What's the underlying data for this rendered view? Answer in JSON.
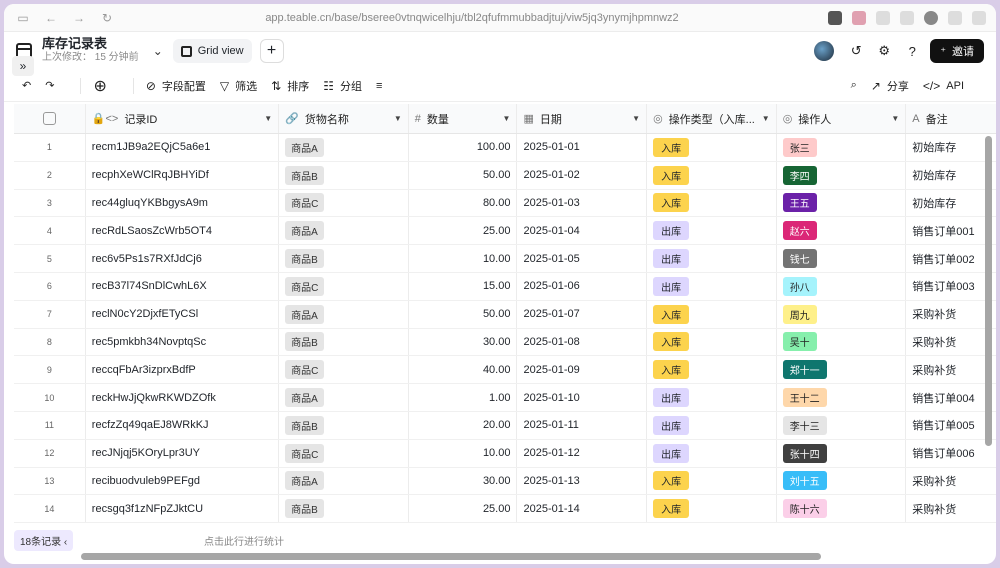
{
  "browser": {
    "url": "app.teable.cn/base/bseree0vtnqwicelhju/tbl2qfufmmubbadjtuj/viw5jq3ynymjhpmnwz2"
  },
  "header": {
    "title": "库存记录表",
    "subtitle": "上次修改： 15 分钟前",
    "view_label": "Grid view",
    "invite_label": "邀请"
  },
  "toolbar": {
    "fields_label": "字段配置",
    "filter_label": "筛选",
    "sort_label": "排序",
    "group_label": "分组",
    "share_label": "分享",
    "api_label": "API"
  },
  "columns": [
    {
      "name": "记录ID",
      "icon": "lock-code-icon"
    },
    {
      "name": "货物名称",
      "icon": "link-icon"
    },
    {
      "name": "数量",
      "icon": "hash-icon"
    },
    {
      "name": "日期",
      "icon": "calendar-icon"
    },
    {
      "name": "操作类型（入库...",
      "icon": "select-icon"
    },
    {
      "name": "操作人",
      "icon": "select-icon"
    },
    {
      "name": "备注",
      "icon": "text-icon"
    }
  ],
  "rows": [
    {
      "n": "1",
      "id": "recm1JB9a2EQjC5a6e1",
      "goods": "商品A",
      "qty": "100.00",
      "date": "2025-01-01",
      "type": "入库",
      "op": "张三",
      "note": "初始库存"
    },
    {
      "n": "2",
      "id": "recphXeWClRqJBHYiDf",
      "goods": "商品B",
      "qty": "50.00",
      "date": "2025-01-02",
      "type": "入库",
      "op": "李四",
      "note": "初始库存"
    },
    {
      "n": "3",
      "id": "rec44gluqYKBbgysA9m",
      "goods": "商品C",
      "qty": "80.00",
      "date": "2025-01-03",
      "type": "入库",
      "op": "王五",
      "note": "初始库存"
    },
    {
      "n": "4",
      "id": "recRdLSaosZcWrb5OT4",
      "goods": "商品A",
      "qty": "25.00",
      "date": "2025-01-04",
      "type": "出库",
      "op": "赵六",
      "note": "销售订单001"
    },
    {
      "n": "5",
      "id": "rec6v5Ps1s7RXfJdCj6",
      "goods": "商品B",
      "qty": "10.00",
      "date": "2025-01-05",
      "type": "出库",
      "op": "钱七",
      "note": "销售订单002"
    },
    {
      "n": "6",
      "id": "recB37l74SnDlCwhL6X",
      "goods": "商品C",
      "qty": "15.00",
      "date": "2025-01-06",
      "type": "出库",
      "op": "孙八",
      "note": "销售订单003"
    },
    {
      "n": "7",
      "id": "reclN0cY2DjxfETyCSl",
      "goods": "商品A",
      "qty": "50.00",
      "date": "2025-01-07",
      "type": "入库",
      "op": "周九",
      "note": "采购补货"
    },
    {
      "n": "8",
      "id": "rec5pmkbh34NovptqSc",
      "goods": "商品B",
      "qty": "30.00",
      "date": "2025-01-08",
      "type": "入库",
      "op": "吴十",
      "note": "采购补货"
    },
    {
      "n": "9",
      "id": "reccqFbAr3izprxBdfP",
      "goods": "商品C",
      "qty": "40.00",
      "date": "2025-01-09",
      "type": "入库",
      "op": "郑十一",
      "note": "采购补货"
    },
    {
      "n": "10",
      "id": "reckHwJjQkwRKWDZOfk",
      "goods": "商品A",
      "qty": "1.00",
      "date": "2025-01-10",
      "type": "出库",
      "op": "王十二",
      "note": "销售订单004"
    },
    {
      "n": "11",
      "id": "recfzZq49qaEJ8WRkKJ",
      "goods": "商品B",
      "qty": "20.00",
      "date": "2025-01-11",
      "type": "出库",
      "op": "李十三",
      "note": "销售订单005"
    },
    {
      "n": "12",
      "id": "recJNjqj5KOryLpr3UY",
      "goods": "商品C",
      "qty": "10.00",
      "date": "2025-01-12",
      "type": "出库",
      "op": "张十四",
      "note": "销售订单006"
    },
    {
      "n": "13",
      "id": "recibuodvuleb9PEFgd",
      "goods": "商品A",
      "qty": "30.00",
      "date": "2025-01-13",
      "type": "入库",
      "op": "刘十五",
      "note": "采购补货"
    },
    {
      "n": "14",
      "id": "recsgq3f1zNFpZJktCU",
      "goods": "商品B",
      "qty": "25.00",
      "date": "2025-01-14",
      "type": "入库",
      "op": "陈十六",
      "note": "采购补货"
    }
  ],
  "type_colors": {
    "入库": "#fcd34d",
    "出库": "#ddd6fe"
  },
  "operator_colors": {
    "张三": [
      "#fecaca",
      "#222"
    ],
    "李四": [
      "#166534",
      "#fff"
    ],
    "王五": [
      "#6b21a8",
      "#fff"
    ],
    "赵六": [
      "#db2777",
      "#fff"
    ],
    "钱七": [
      "#737373",
      "#fff"
    ],
    "孙八": [
      "#a5f3fc",
      "#222"
    ],
    "周九": [
      "#fef08a",
      "#222"
    ],
    "吴十": [
      "#86efac",
      "#222"
    ],
    "郑十一": [
      "#0f766e",
      "#fff"
    ],
    "王十二": [
      "#fed7aa",
      "#222"
    ],
    "李十三": [
      "#e5e5e5",
      "#222"
    ],
    "张十四": [
      "#404040",
      "#fff"
    ],
    "刘十五": [
      "#38bdf8",
      "#fff"
    ],
    "陈十六": [
      "#fbcfe8",
      "#222"
    ]
  },
  "footer": {
    "count_label": "18条记录",
    "stats_label": "点击此行进行统计"
  }
}
